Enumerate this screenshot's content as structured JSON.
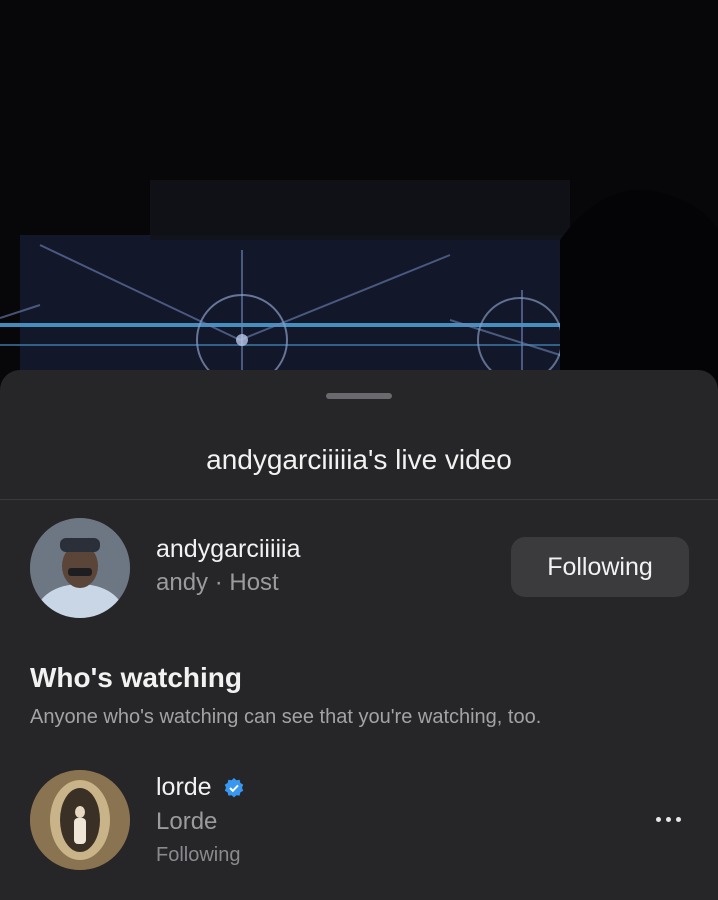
{
  "video": {
    "description_icon": "live-video-stage"
  },
  "sheet": {
    "title": "andygarciiiiia's live video"
  },
  "host": {
    "username": "andygarciiiiia",
    "subtitle": "andy · Host",
    "follow_button_label": "Following"
  },
  "watching": {
    "title": "Who's watching",
    "description": "Anyone who's watching can see that you're watching, too."
  },
  "viewers": [
    {
      "username": "lorde",
      "verified": true,
      "display_name": "Lorde",
      "status": "Following",
      "more_icon": "more-horizontal-icon"
    }
  ],
  "colors": {
    "sheet_bg": "#262628",
    "button_bg": "#3b3b3e",
    "verified_blue": "#3897f0",
    "secondary_text": "#9b9b9f"
  }
}
